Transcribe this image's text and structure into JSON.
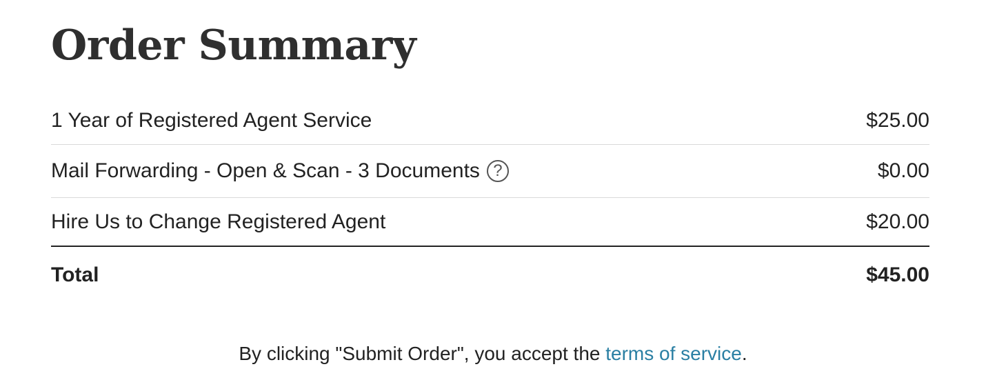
{
  "page": {
    "title": "Order Summary"
  },
  "order": {
    "items": [
      {
        "label": "1 Year of Registered Agent Service",
        "price": "$25.00"
      },
      {
        "label": "Mail Forwarding - Open & Scan - 3 Documents",
        "price": "$0.00",
        "help_icon": "question-circle-icon",
        "help_glyph": "?"
      },
      {
        "label": "Hire Us to Change Registered Agent",
        "price": "$20.00"
      }
    ],
    "total_label": "Total",
    "total_price": "$45.00"
  },
  "terms": {
    "prefix": "By clicking \"Submit Order\", you accept the ",
    "link_text": "terms of service",
    "suffix": "."
  },
  "colors": {
    "link": "#2a7fa3",
    "title": "#2f2f2f",
    "divider": "#d9d9d9"
  }
}
